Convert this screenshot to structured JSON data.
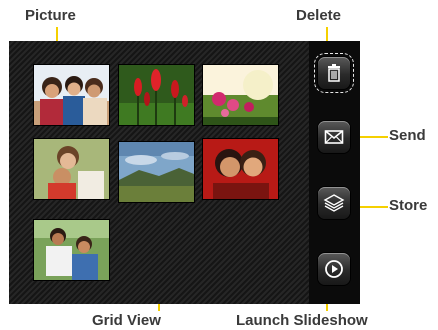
{
  "callouts": {
    "picture": "Picture",
    "delete": "Delete",
    "send": "Send",
    "store": "Store",
    "grid_view": "Grid View",
    "launch_slideshow": "Launch Slideshow"
  },
  "accent_color": "#f5d000",
  "grid": {
    "thumbnails": [
      {
        "name": "thumb-family-group",
        "subject": "family group"
      },
      {
        "name": "thumb-red-flowers",
        "subject": "red flowers"
      },
      {
        "name": "thumb-pink-flowers",
        "subject": "pink flowers"
      },
      {
        "name": "thumb-mother-child",
        "subject": "mother and child"
      },
      {
        "name": "thumb-landscape",
        "subject": "landscape"
      },
      {
        "name": "thumb-two-girls",
        "subject": "two girls"
      },
      {
        "name": "thumb-father-son",
        "subject": "father and son"
      }
    ]
  },
  "toolbar": {
    "buttons": [
      {
        "name": "delete-button",
        "icon": "trash-icon",
        "selected": true
      },
      {
        "name": "send-button",
        "icon": "envelope-icon",
        "selected": false
      },
      {
        "name": "store-button",
        "icon": "stack-icon",
        "selected": false
      },
      {
        "name": "slideshow-button",
        "icon": "play-icon",
        "selected": false
      }
    ]
  }
}
